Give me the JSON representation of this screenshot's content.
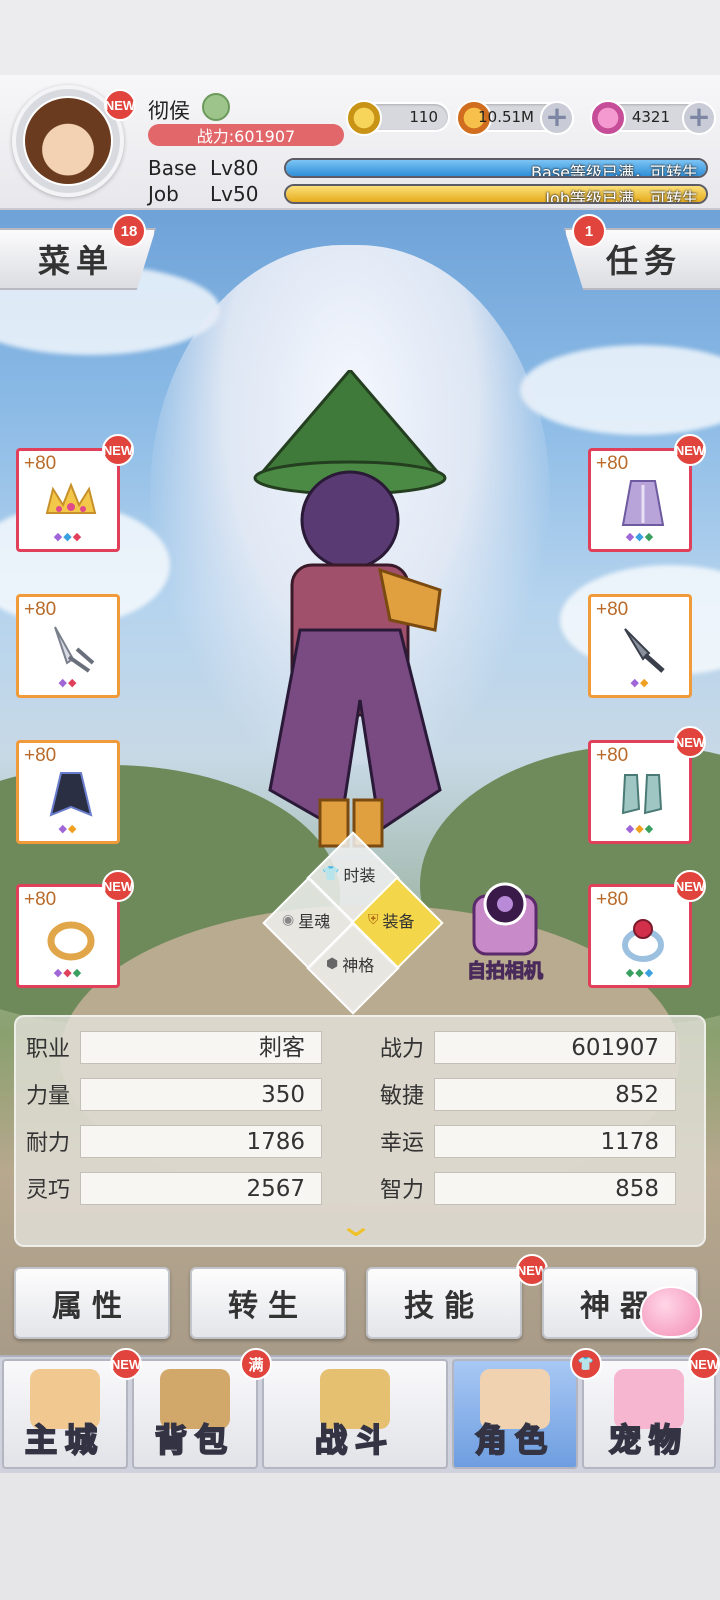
{
  "header": {
    "player_name": "彻侯",
    "power_text": "战力:601907",
    "avatar_badge": "NEW",
    "base_label": "Base",
    "base_level": "Lv80",
    "base_status": "Base等级已满，可转生",
    "job_label": "Job",
    "job_level": "Lv50",
    "job_status": "Job等级已满，可转生",
    "base_progress": 1.0,
    "job_progress": 1.0
  },
  "resources": [
    {
      "icon": "zeny-coin-icon",
      "value": "110"
    },
    {
      "icon": "gold-coin-icon",
      "value": "10.51M"
    },
    {
      "icon": "pink-gem-icon",
      "value": "4321"
    }
  ],
  "menu_tab": {
    "label": "菜单",
    "badge": "18"
  },
  "quest_tab": {
    "label": "任务",
    "badge": "1"
  },
  "equipment_left": [
    {
      "plus": "+80",
      "badge": "NEW",
      "item": "crown-icon",
      "border": "pink"
    },
    {
      "plus": "+80",
      "badge": "",
      "item": "katar-weapon-icon",
      "border": "orange"
    },
    {
      "plus": "+80",
      "badge": "",
      "item": "cape-icon",
      "border": "orange"
    },
    {
      "plus": "+80",
      "badge": "NEW",
      "item": "gold-ring-icon",
      "border": "pink"
    }
  ],
  "equipment_right": [
    {
      "plus": "+80",
      "badge": "NEW",
      "item": "robe-armor-icon",
      "border": "pink"
    },
    {
      "plus": "+80",
      "badge": "",
      "item": "dagger-weapon-icon",
      "border": "orange"
    },
    {
      "plus": "+80",
      "badge": "NEW",
      "item": "boots-icon",
      "border": "pink"
    },
    {
      "plus": "+80",
      "badge": "NEW",
      "item": "ruby-ring-icon",
      "border": "pink"
    }
  ],
  "mode_selector": {
    "fashion": "时装",
    "star_soul": "星魂",
    "equip": "装备",
    "divine": "神格"
  },
  "selfie_camera": "自拍相机",
  "stats": {
    "rows": [
      {
        "left_label": "职业",
        "left_value": "刺客",
        "right_label": "战力",
        "right_value": "601907"
      },
      {
        "left_label": "力量",
        "left_value": "350",
        "right_label": "敏捷",
        "right_value": "852"
      },
      {
        "left_label": "耐力",
        "left_value": "1786",
        "right_label": "幸运",
        "right_value": "1178"
      },
      {
        "left_label": "灵巧",
        "left_value": "2567",
        "right_label": "智力",
        "right_value": "858"
      }
    ]
  },
  "action_tabs": [
    {
      "label": "属性",
      "badge": ""
    },
    {
      "label": "转生",
      "badge": ""
    },
    {
      "label": "技能",
      "badge": "NEW"
    },
    {
      "label": "神器",
      "badge": ""
    }
  ],
  "bottom_nav": [
    {
      "label": "主城",
      "badge": "NEW",
      "active": false
    },
    {
      "label": "背包",
      "badge": "满",
      "active": false
    },
    {
      "label": "战斗",
      "badge": "",
      "active": false
    },
    {
      "label": "角色",
      "badge": "shirt-icon",
      "active": true
    },
    {
      "label": "宠物",
      "badge": "NEW",
      "active": false
    }
  ],
  "colors": {
    "base_bar": "#3fa0e6",
    "job_bar": "#f0c43a",
    "power_pill": "#e2676a",
    "badge_red": "#e0443c",
    "active_nav": "#8ab6ec"
  }
}
